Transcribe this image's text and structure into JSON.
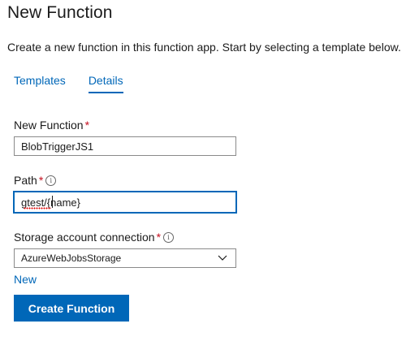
{
  "header": {
    "title": "New Function",
    "subtitle": "Create a new function in this function app. Start by selecting a template below."
  },
  "tabs": [
    {
      "label": "Templates",
      "active": false
    },
    {
      "label": "Details",
      "active": true
    }
  ],
  "form": {
    "name_field": {
      "label": "New Function",
      "required_mark": "*",
      "value": "BlobTriggerJS1"
    },
    "path_field": {
      "label": "Path",
      "required_mark": "*",
      "info_icon": "i",
      "value": "gtest/{name}"
    },
    "storage_field": {
      "label": "Storage account connection",
      "required_mark": "*",
      "info_icon": "i",
      "selected": "AzureWebJobsStorage"
    },
    "new_link": "New",
    "submit_label": "Create Function"
  },
  "colors": {
    "accent": "#0067b8",
    "required": "#c50f1f"
  }
}
